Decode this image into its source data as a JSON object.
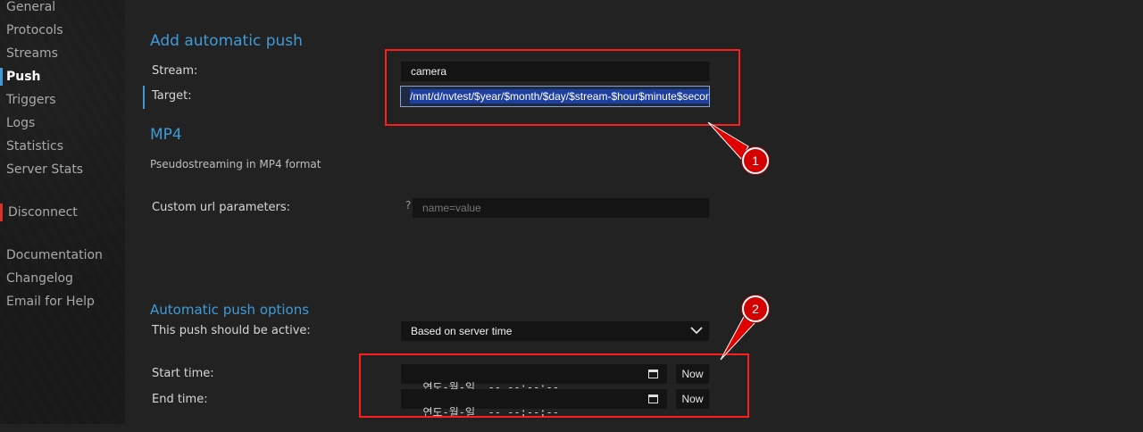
{
  "sidebar": {
    "items": [
      {
        "label": "General"
      },
      {
        "label": "Protocols"
      },
      {
        "label": "Streams"
      },
      {
        "label": "Push"
      },
      {
        "label": "Triggers"
      },
      {
        "label": "Logs"
      },
      {
        "label": "Statistics"
      },
      {
        "label": "Server Stats"
      },
      {
        "label": "Disconnect"
      },
      {
        "label": "Documentation"
      },
      {
        "label": "Changelog"
      },
      {
        "label": "Email for Help"
      }
    ],
    "active": "Push"
  },
  "form": {
    "title": "Add automatic push",
    "stream_label": "Stream:",
    "stream_value": "camera",
    "target_label": "Target:",
    "target_value": "/mnt/d/nvtest/$year/$month/$day/$stream-$hour$minute$secon",
    "mp4_title": "MP4",
    "mp4_desc": "Pseudostreaming in MP4 format",
    "custom_label": "Custom url parameters:",
    "custom_help": "?",
    "custom_placeholder": "name=value",
    "options_title": "Automatic push options",
    "active_label": "This push should be active:",
    "active_value": "Based on server time",
    "start_label": "Start time:",
    "start_value": "연도-월-일  -- --:--:--",
    "end_label": "End time:",
    "end_value": "연도-월-일  -- --:--:--",
    "now_label": "Now"
  },
  "annotations": {
    "badge1": "1",
    "badge2": "2",
    "color": "#ff1e1e"
  },
  "colors": {
    "accent": "#3f9bd8",
    "disconnect_marker": "#d9322b",
    "background": "#222222",
    "sidebar": "#1a1a1a"
  }
}
